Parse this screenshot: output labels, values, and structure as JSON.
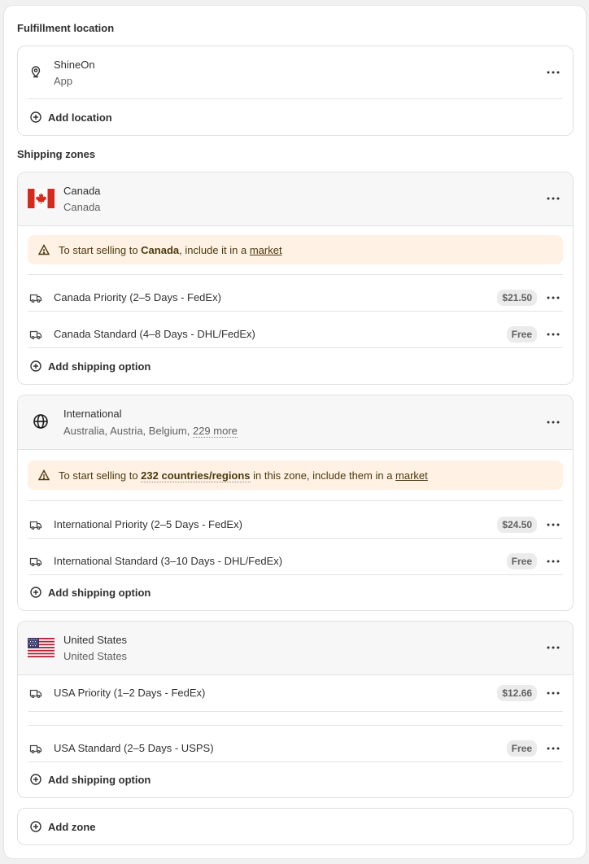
{
  "fulfillment": {
    "heading": "Fulfillment location",
    "location_name": "ShineOn",
    "location_type": "App",
    "add_location": "Add location"
  },
  "shipping": {
    "heading": "Shipping zones",
    "zones": [
      {
        "name": "Canada",
        "countries": "Canada",
        "banner_prefix": "To start selling to ",
        "banner_bold": "Canada",
        "banner_mid": ", include it in a ",
        "banner_link": "market",
        "rates": [
          {
            "name": "Canada Priority (2–5 Days - FedEx)",
            "price": "$21.50"
          },
          {
            "name": "Canada Standard (4–8 Days - DHL/FedEx)",
            "price": "Free"
          }
        ],
        "add_option": "Add shipping option"
      },
      {
        "name": "International",
        "countries": "Australia, Austria, Belgium, ",
        "more": "229 more",
        "banner_prefix": "To start selling to ",
        "banner_bold": "232 countries/regions",
        "banner_mid": " in this zone, include them in a ",
        "banner_link": "market",
        "rates": [
          {
            "name": "International Priority (2–5 Days - FedEx)",
            "price": "$24.50"
          },
          {
            "name": "International Standard (3–10 Days - DHL/FedEx)",
            "price": "Free"
          }
        ],
        "add_option": "Add shipping option"
      },
      {
        "name": "United States",
        "countries": "United States",
        "rates": [
          {
            "name": "USA Priority (1–2 Days - FedEx)",
            "price": "$12.66"
          },
          {
            "name": "USA Standard (2–5 Days - USPS)",
            "price": "Free"
          }
        ],
        "add_option": "Add shipping option"
      }
    ],
    "add_zone": "Add zone"
  },
  "icons": {
    "location": "location-pin-icon",
    "more": "more-horizontal-icon",
    "add": "plus-circle-icon",
    "warning": "alert-triangle-icon",
    "truck": "delivery-truck-icon",
    "globe": "globe-icon",
    "flag_ca": "canada-flag-icon",
    "flag_us": "usa-flag-icon"
  },
  "colors": {
    "banner_bg": "#fff1e3",
    "header_bg": "#f7f7f7",
    "badge_bg": "#ebebeb"
  }
}
